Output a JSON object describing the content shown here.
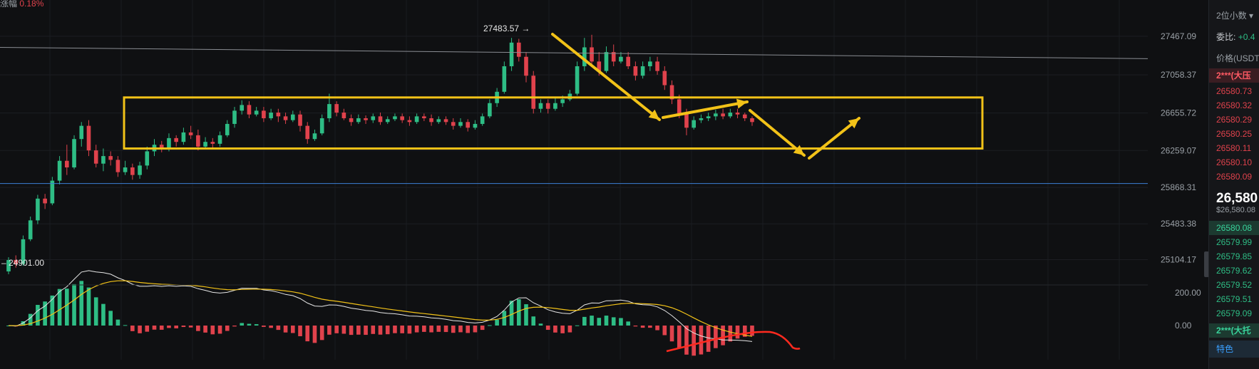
{
  "header": {
    "change_label": "涨幅",
    "change_value": "0.18%"
  },
  "chart_data": {
    "type": "candlestick",
    "y_axis_ticks": [
      "27467.09",
      "27058.37",
      "26655.72",
      "26259.07",
      "25868.31",
      "25483.38",
      "25104.17"
    ],
    "ylim": [
      24950,
      27700
    ],
    "high_label": "27483.57",
    "low_label": "24901.00",
    "macd_ticks": [
      "200.00",
      "0.00"
    ],
    "consolidation_box": {
      "top": 26820,
      "bottom": 26280,
      "x_start_bar": 40,
      "x_end_bar": 320
    },
    "horizontal_line_price": 25910,
    "trend_line": {
      "from_price": 27350,
      "to_price": 27230
    },
    "candles": [
      [
        24980,
        25100,
        24950,
        25130
      ],
      [
        25100,
        25060,
        25020,
        25150
      ],
      [
        25060,
        25320,
        25040,
        25360
      ],
      [
        25320,
        25520,
        25300,
        25560
      ],
      [
        25520,
        25750,
        25480,
        25790
      ],
      [
        25750,
        25700,
        25640,
        25800
      ],
      [
        25700,
        25940,
        25680,
        25980
      ],
      [
        25940,
        26150,
        25900,
        26200
      ],
      [
        26150,
        26080,
        26000,
        26320
      ],
      [
        26080,
        26380,
        26060,
        26420
      ],
      [
        26380,
        26520,
        26300,
        26560
      ],
      [
        26520,
        26260,
        26200,
        26580
      ],
      [
        26260,
        26120,
        26080,
        26320
      ],
      [
        26120,
        26200,
        26040,
        26280
      ],
      [
        26200,
        26160,
        26100,
        26250
      ],
      [
        26160,
        26030,
        25980,
        26200
      ],
      [
        26030,
        26080,
        26000,
        26150
      ],
      [
        26080,
        26000,
        25950,
        26120
      ],
      [
        26000,
        26100,
        25960,
        26140
      ],
      [
        26100,
        26250,
        26060,
        26300
      ],
      [
        26250,
        26320,
        26200,
        26380
      ],
      [
        26320,
        26280,
        26240,
        26360
      ],
      [
        26280,
        26390,
        26250,
        26440
      ],
      [
        26390,
        26350,
        26300,
        26420
      ],
      [
        26350,
        26450,
        26320,
        26500
      ],
      [
        26450,
        26420,
        26380,
        26520
      ],
      [
        26420,
        26300,
        26260,
        26480
      ],
      [
        26300,
        26350,
        26280,
        26400
      ],
      [
        26350,
        26330,
        26290,
        26390
      ],
      [
        26330,
        26420,
        26300,
        26460
      ],
      [
        26420,
        26540,
        26400,
        26580
      ],
      [
        26540,
        26680,
        26500,
        26720
      ],
      [
        26680,
        26740,
        26640,
        26790
      ],
      [
        26740,
        26640,
        26600,
        26780
      ],
      [
        26640,
        26680,
        26620,
        26720
      ],
      [
        26680,
        26600,
        26560,
        26720
      ],
      [
        26600,
        26660,
        26580,
        26700
      ],
      [
        26660,
        26620,
        26560,
        26700
      ],
      [
        26620,
        26580,
        26540,
        26660
      ],
      [
        26580,
        26640,
        26560,
        26680
      ],
      [
        26640,
        26520,
        26460,
        26680
      ],
      [
        26520,
        26380,
        26330,
        26560
      ],
      [
        26380,
        26440,
        26360,
        26480
      ],
      [
        26440,
        26600,
        26420,
        26640
      ],
      [
        26600,
        26750,
        26560,
        26860
      ],
      [
        26750,
        26660,
        26620,
        26780
      ],
      [
        26660,
        26600,
        26580,
        26700
      ],
      [
        26600,
        26560,
        26520,
        26640
      ],
      [
        26560,
        26600,
        26540,
        26640
      ],
      [
        26600,
        26580,
        26540,
        26630
      ],
      [
        26580,
        26620,
        26550,
        26650
      ],
      [
        26620,
        26560,
        26530,
        26660
      ],
      [
        26560,
        26590,
        26540,
        26620
      ],
      [
        26590,
        26620,
        26570,
        26650
      ],
      [
        26620,
        26580,
        26550,
        26650
      ],
      [
        26580,
        26560,
        26520,
        26620
      ],
      [
        26560,
        26620,
        26540,
        26650
      ],
      [
        26620,
        26600,
        26570,
        26650
      ],
      [
        26600,
        26560,
        26520,
        26640
      ],
      [
        26560,
        26590,
        26540,
        26620
      ],
      [
        26590,
        26560,
        26530,
        26620
      ],
      [
        26560,
        26520,
        26480,
        26600
      ],
      [
        26520,
        26560,
        26500,
        26600
      ],
      [
        26560,
        26500,
        26460,
        26590
      ],
      [
        26500,
        26540,
        26480,
        26580
      ],
      [
        26540,
        26620,
        26520,
        26650
      ],
      [
        26620,
        26760,
        26600,
        26800
      ],
      [
        26760,
        26880,
        26720,
        26920
      ],
      [
        26880,
        27150,
        26860,
        27200
      ],
      [
        27150,
        27400,
        27100,
        27450
      ],
      [
        27400,
        27250,
        27200,
        27440
      ],
      [
        27250,
        27050,
        26980,
        27300
      ],
      [
        27050,
        26700,
        26650,
        27100
      ],
      [
        26700,
        26760,
        26660,
        26800
      ],
      [
        26760,
        26700,
        26650,
        26800
      ],
      [
        26700,
        26760,
        26680,
        26820
      ],
      [
        26760,
        26800,
        26720,
        26840
      ],
      [
        26800,
        26860,
        26780,
        26900
      ],
      [
        26860,
        27150,
        26840,
        27200
      ],
      [
        27150,
        27350,
        27100,
        27450
      ],
      [
        27350,
        27200,
        27150,
        27483
      ],
      [
        27200,
        27100,
        27050,
        27300
      ],
      [
        27100,
        27300,
        27080,
        27360
      ],
      [
        27300,
        27200,
        27150,
        27380
      ],
      [
        27200,
        27250,
        27180,
        27300
      ],
      [
        27250,
        27150,
        27120,
        27300
      ],
      [
        27150,
        27050,
        27000,
        27200
      ],
      [
        27050,
        27150,
        27020,
        27200
      ],
      [
        27150,
        27200,
        27100,
        27250
      ],
      [
        27200,
        27100,
        27060,
        27250
      ],
      [
        27100,
        26950,
        26900,
        27150
      ],
      [
        26950,
        26800,
        26750,
        27000
      ],
      [
        26800,
        26650,
        26600,
        26850
      ],
      [
        26650,
        26500,
        26420,
        26700
      ],
      [
        26500,
        26580,
        26480,
        26620
      ],
      [
        26580,
        26600,
        26550,
        26640
      ],
      [
        26600,
        26620,
        26570,
        26660
      ],
      [
        26620,
        26650,
        26580,
        26690
      ],
      [
        26650,
        26620,
        26590,
        26700
      ],
      [
        26620,
        26660,
        26600,
        26700
      ],
      [
        26660,
        26640,
        26600,
        26700
      ],
      [
        26640,
        26600,
        26570,
        26660
      ],
      [
        26600,
        26560,
        26520,
        26620
      ]
    ]
  },
  "orderbook": {
    "precision": "2位小数",
    "ratio_label": "委比:",
    "ratio_value": "+0.4",
    "price_header": "价格(USDT",
    "big_ask": "2***(大压",
    "asks": [
      "26580.73",
      "26580.32",
      "26580.29",
      "26580.25",
      "26580.11",
      "26580.10",
      "26580.09"
    ],
    "last_price": "26,580",
    "last_price_usd": "$26,580.08",
    "top_bid": "26580.08",
    "bids": [
      "26579.99",
      "26579.85",
      "26579.62",
      "26579.52",
      "26579.51",
      "26579.09"
    ],
    "big_bid": "2***(大托",
    "feature_tab": "特色"
  },
  "colors": {
    "up": "#2ebd85",
    "down": "#e0424c",
    "box": "#f2c218",
    "arrow": "#f2c218"
  }
}
